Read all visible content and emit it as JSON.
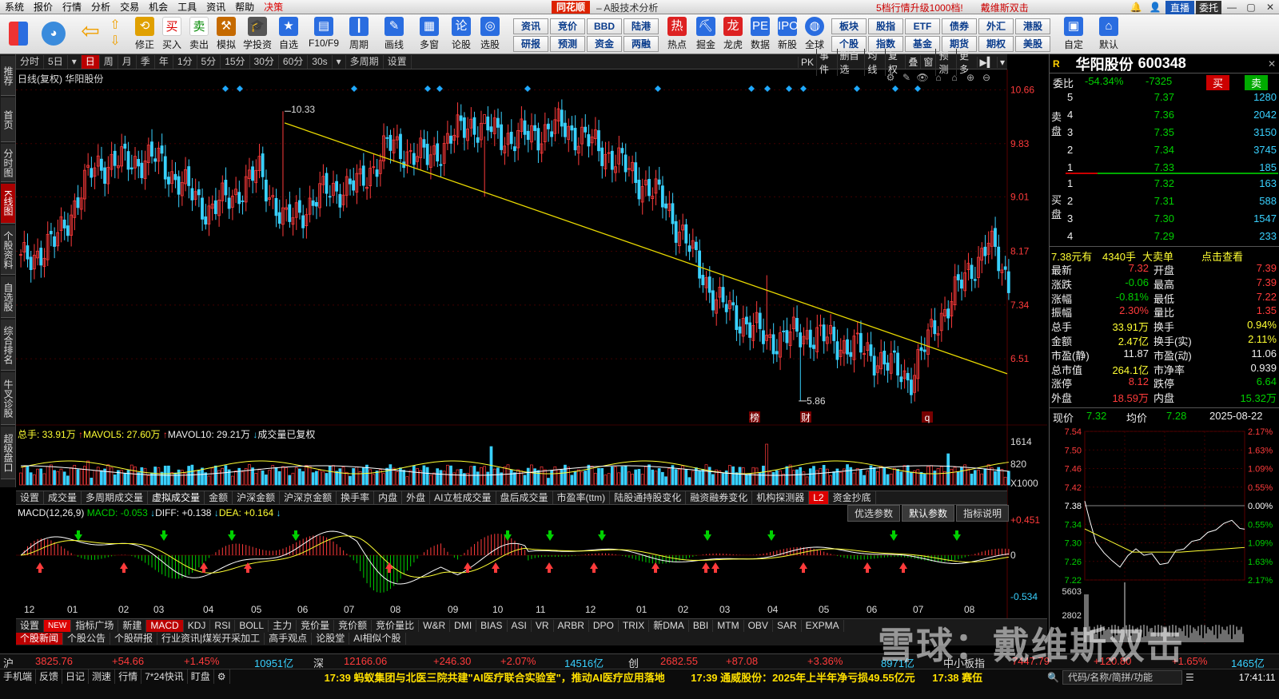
{
  "menu": [
    "系统",
    "报价",
    "行情",
    "分析",
    "交易",
    "机会",
    "工具",
    "资讯",
    "帮助",
    "决策"
  ],
  "app": {
    "logo": "同花顺",
    "subtitle": "– A股技术分析",
    "promo1": "5档行情升级1000档!",
    "promo2": "戴维斯双击",
    "live": "直播",
    "user": "委托"
  },
  "toolbar": [
    "修正",
    "买入",
    "卖出",
    "模拟",
    "学投资",
    "自选",
    "F10/F9",
    "周期",
    "画线",
    "多窗",
    "论股",
    "选股"
  ],
  "toolbar_grid": [
    [
      "资讯",
      "竞价",
      "BBD",
      "陆港"
    ],
    [
      "研报",
      "预测",
      "资金",
      "两融"
    ]
  ],
  "toolbar_right": [
    "热点",
    "掘金",
    "龙虎",
    "数据",
    "新股",
    "全球"
  ],
  "toolbar_grid2": [
    [
      "板块",
      "股指",
      "ETF",
      "债券",
      "外汇",
      "港股"
    ],
    [
      "个股",
      "指数",
      "基金",
      "期货",
      "期权",
      "美股"
    ]
  ],
  "toolbar_far": [
    "自定",
    "默认"
  ],
  "left_tabs": [
    "推荐",
    "首页",
    "分时图",
    "K线图",
    "个股资料",
    "自选股",
    "综合排名",
    "牛叉诊股",
    "超级盘口"
  ],
  "periods": [
    "分时",
    "5日",
    "日",
    "周",
    "月",
    "季",
    "年",
    "1分",
    "5分",
    "15分",
    "30分",
    "60分",
    "30s",
    "多周期",
    "设置"
  ],
  "period_right": [
    "PK",
    "事件",
    "删自选",
    "均线",
    "复权",
    "叠",
    "窗",
    "预测",
    "更多"
  ],
  "chart_label": "日线(复权) 华阳股份",
  "price_axis": [
    "10.66",
    "9.83",
    "9.01",
    "8.17",
    "7.34",
    "6.51"
  ],
  "annotations": {
    "high": "10.33",
    "low": "5.86",
    "markers": [
      "榜",
      "财",
      "q"
    ]
  },
  "vol_info": {
    "total": "总手: 33.91万",
    "ma5": "MAVOL5: 27.60万",
    "ma10": "MAVOL10: 29.21万",
    "note": "成交量已复权"
  },
  "vol_axis": [
    "1614",
    "820",
    "X1000"
  ],
  "ind1_tabs": [
    "设置",
    "成交量",
    "多周期成交量",
    "虚拟成交量",
    "金额",
    "沪深金额",
    "沪深京金额",
    "换手率",
    "内盘",
    "外盘",
    "AI立桩成交量",
    "盘后成交量",
    "市盈率(ttm)",
    "陆股通持股变化",
    "融资融券变化",
    "机构探测器",
    "L2",
    "资金抄底"
  ],
  "macd_info": {
    "name": "MACD(12,26,9)",
    "macd": "MACD: -0.053",
    "diff": "DIFF: +0.138",
    "dea": "DEA: +0.164"
  },
  "macd_btns": [
    "优选参数",
    "默认参数",
    "指标说明"
  ],
  "macd_axis": [
    "+0.451",
    "0",
    "-0.534"
  ],
  "months": [
    "12",
    "01",
    "02",
    "03",
    "04",
    "05",
    "06",
    "07",
    "08",
    "09",
    "10",
    "11",
    "12",
    "01",
    "02",
    "03",
    "04",
    "05",
    "06",
    "07",
    "08"
  ],
  "ind2_tabs": [
    "设置",
    "NEW",
    "指标广场",
    "新建",
    "MACD",
    "KDJ",
    "RSI",
    "BOLL",
    "主力",
    "竞价量",
    "竞价额",
    "竞价量比",
    "W&R",
    "DMI",
    "BIAS",
    "ASI",
    "VR",
    "ARBR",
    "DPO",
    "TRIX",
    "新DMA",
    "BBI",
    "MTM",
    "OBV",
    "SAR",
    "EXPMA"
  ],
  "news_tabs": [
    "个股新闻",
    "个股公告",
    "个股研报",
    "行业资讯|煤炭开采加工",
    "高手观点",
    "论股堂",
    "AI相似个股"
  ],
  "index_bar": [
    [
      "沪",
      "3825.76",
      "+54.66",
      "+1.45%",
      "10951亿"
    ],
    [
      "深",
      "12166.06",
      "+246.30",
      "+2.07%",
      "14516亿"
    ],
    [
      "创",
      "2682.55",
      "+87.08",
      "+3.36%",
      "8971亿"
    ],
    [
      "中小板指",
      "7447.79",
      "+120.80",
      "+1.65%",
      "1465亿"
    ]
  ],
  "status": [
    "手机端",
    "反馈",
    "日记",
    "测速",
    "行情",
    "7*24快讯",
    "盯盘"
  ],
  "ticker": [
    {
      "time": "17:39",
      "text": "蚂蚁集团与北医三院共建\"AI医疗联合实验室\"，推动AI医疗应用落地"
    },
    {
      "time": "17:39",
      "text": "通威股份：2025年上半年净亏损49.55亿元"
    },
    {
      "time": "17:38",
      "text": "赛伍"
    }
  ],
  "search_hint": "代码/名称/简拼/功能",
  "clock": "17:41:11",
  "stock": {
    "letter": "R",
    "name": "华阳股份",
    "code": "600348"
  },
  "weibi": {
    "label": "委比",
    "pct": "-54.34%",
    "diff": "-7325",
    "buy": "买",
    "sell": "卖"
  },
  "asks": [
    [
      "5",
      "7.37",
      "1280"
    ],
    [
      "4",
      "7.36",
      "2042"
    ],
    [
      "3",
      "7.35",
      "3150"
    ],
    [
      "2",
      "7.34",
      "3745"
    ],
    [
      "1",
      "7.33",
      "185"
    ]
  ],
  "bids": [
    [
      "1",
      "7.32",
      "163"
    ],
    [
      "2",
      "7.31",
      "588"
    ],
    [
      "3",
      "7.30",
      "1547"
    ],
    [
      "4",
      "7.29",
      "233"
    ]
  ],
  "ask_label": "卖盘",
  "bid_label": "买盘",
  "bigorder": {
    "price": "7.38元有",
    "vol": "4340手",
    "label": "大卖单",
    "link": "点击查看"
  },
  "quote": [
    [
      "最新",
      "7.32",
      "开盘",
      "7.39"
    ],
    [
      "涨跌",
      "-0.06",
      "最高",
      "7.39"
    ],
    [
      "涨幅",
      "-0.81%",
      "最低",
      "7.22"
    ],
    [
      "振幅",
      "2.30%",
      "量比",
      "1.35"
    ],
    [
      "总手",
      "33.91万",
      "换手",
      "0.94%"
    ],
    [
      "金额",
      "2.47亿",
      "换手(实)",
      "2.11%"
    ],
    [
      "市盈(静)",
      "11.87",
      "市盈(动)",
      "11.06"
    ],
    [
      "总市值",
      "264.1亿",
      "市净率",
      "0.939"
    ],
    [
      "涨停",
      "8.12",
      "跌停",
      "6.64"
    ],
    [
      "外盘",
      "18.59万",
      "内盘",
      "15.32万"
    ]
  ],
  "intraday": {
    "label_now": "现价",
    "now": "7.32",
    "label_avg": "均价",
    "avg": "7.28",
    "date": "2025-08-22",
    "prices": [
      "7.54",
      "7.50",
      "7.46",
      "7.42",
      "7.38",
      "7.34",
      "7.30",
      "7.26",
      "7.22"
    ],
    "pcts": [
      "2.17%",
      "1.63%",
      "1.09%",
      "0.55%",
      "0.00%",
      "0.55%",
      "1.09%",
      "1.63%",
      "2.17%"
    ],
    "vol": [
      "5603",
      "2802"
    ]
  },
  "watermark": "雪球：戴维斯双击",
  "colors": {
    "up": "#ff3b3b",
    "down": "#39d1ff",
    "trend": "#e8d800",
    "ma": "#ffffff"
  },
  "chart_data": {
    "type": "candlestick",
    "title": "华阳股份",
    "high": 10.33,
    "low": 5.86,
    "last": 7.32,
    "ylim": [
      5.6,
      10.9
    ]
  }
}
